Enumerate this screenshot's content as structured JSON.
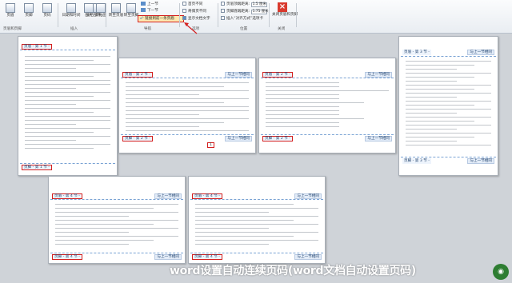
{
  "ribbon": {
    "buttons": [
      {
        "label": "页眉",
        "icon": "header-icon"
      },
      {
        "label": "页脚",
        "icon": "footer-icon"
      },
      {
        "label": "页码",
        "icon": "page-number-icon"
      },
      {
        "label": "日期和时间",
        "icon": "date-time-icon"
      },
      {
        "label": "文档部件",
        "icon": "doc-parts-icon"
      },
      {
        "label": "图片",
        "icon": "picture-icon"
      },
      {
        "label": "剪贴画",
        "icon": "clipart-icon"
      },
      {
        "label": "转至页眉",
        "icon": "goto-header-icon"
      },
      {
        "label": "转至页脚",
        "icon": "goto-footer-icon"
      }
    ],
    "nav_prev": "上一节",
    "nav_next": "下一节",
    "link_previous": "链接到前一条页眉",
    "opt_first_page": "首页不同",
    "opt_odd_even": "奇偶页不同",
    "opt_show_text": "显示文档文字",
    "pos_header_dist_label": "页眉顶端距离:",
    "pos_header_dist_value": "1.5 厘米",
    "pos_footer_dist_label": "页脚底端距离:",
    "pos_footer_dist_value": "1.75 厘米",
    "pos_align_tab": "插入“对齐方式”选项卡",
    "close_label": "关闭页眉和页脚",
    "groups": {
      "hf": "页眉和页脚",
      "insert": "插入",
      "nav": "导航",
      "options": "选项",
      "position": "位置",
      "close": "关闭"
    }
  },
  "pages": {
    "p1_header": "页眉 - 第 1 节 -",
    "p1_footer": "页脚 - 第 1 节 -",
    "p2_header": "页眉 - 第 2 节 -",
    "p2_footer": "页脚 - 第 2 节 -",
    "p3_header": "页眉 - 第 2 节 -",
    "p3_footer": "页脚 - 第 2 节 -",
    "p4_header": "页眉 - 第 3 节 -",
    "p4_footer": "页脚 - 第 3 节 -",
    "p5_header": "页眉 - 第 4 节 -",
    "p5_footer": "页脚 - 第 4 节 -",
    "p6_header": "页眉 - 第 4 节 -",
    "p6_footer": "页脚 - 第 4 节 -",
    "link_same": "与上一节相同",
    "marker": "1"
  },
  "caption": "word设置自动连续页码(word文档自动设置页码)"
}
